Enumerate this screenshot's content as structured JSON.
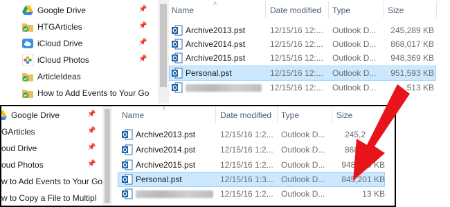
{
  "colors": {
    "selection": "#cce8ff",
    "selection_border": "#99d1ff",
    "header_text": "#4c607a",
    "arrow": "#e8141b"
  },
  "back": {
    "sidebar": [
      {
        "label": "Google Drive",
        "icon": "google-drive-icon"
      },
      {
        "label": "HTGArticles",
        "icon": "folder-sync-icon"
      },
      {
        "label": "iCloud Drive",
        "icon": "icloud-drive-icon"
      },
      {
        "label": "iCloud Photos",
        "icon": "icloud-photos-icon"
      },
      {
        "label": "ArticleIdeas",
        "icon": "folder-sync-icon"
      },
      {
        "label": "How to Add Events to Your Go",
        "icon": "folder-sync-icon"
      }
    ],
    "columns": {
      "name": "Name",
      "date": "Date modified",
      "type": "Type",
      "size": "Size"
    },
    "rows": [
      {
        "name": "Archive2013.pst",
        "date": "12/15/16 12:...",
        "type": "Outlook D...",
        "size": "245,289 KB"
      },
      {
        "name": "Archive2014.pst",
        "date": "12/15/16 12:...",
        "type": "Outlook D...",
        "size": "868,017 KB"
      },
      {
        "name": "Archive2015.pst",
        "date": "12/15/16 12:...",
        "type": "Outlook D...",
        "size": "948,369 KB"
      },
      {
        "name": "Personal.pst",
        "date": "12/15/16 12:...",
        "type": "Outlook D...",
        "size": "951,593 KB",
        "selected": true
      },
      {
        "name": "",
        "date": "12/15/16 12:...",
        "type": "Outlook D...",
        "size": "513 KB"
      }
    ]
  },
  "front": {
    "sidebar": [
      {
        "label": "Google Drive",
        "icon": "google-drive-icon"
      },
      {
        "label": "GArticles",
        "icon": "folder-sync-icon"
      },
      {
        "label": "oud Drive",
        "icon": "icloud-drive-icon"
      },
      {
        "label": "oud Photos",
        "icon": "icloud-photos-icon"
      },
      {
        "label": "w to Add Events to Your Go",
        "icon": "folder-sync-icon"
      },
      {
        "label": "w to Copy a File to Multipl",
        "icon": "folder-sync-icon"
      }
    ],
    "columns": {
      "name": "Name",
      "date": "Date modified",
      "type": "Type",
      "size": "Size"
    },
    "rows": [
      {
        "name": "Archive2013.pst",
        "date": "12/15/16 1:2...",
        "type": "Outlook D...",
        "size": "245,2"
      },
      {
        "name": "Archive2014.pst",
        "date": "12/15/16 1:2...",
        "type": "Outlook D...",
        "size": "868,0"
      },
      {
        "name": "Archive2015.pst",
        "date": "12/15/16 1:2...",
        "type": "Outlook D...",
        "size": "948,369 KB"
      },
      {
        "name": "Personal.pst",
        "date": "12/15/16 1:3...",
        "type": "Outlook D...",
        "size": "845,201 KB",
        "selected": true
      },
      {
        "name": "",
        "date": "12/15/16 1:2...",
        "type": "Outlook D...",
        "size": "13 KB"
      }
    ]
  }
}
